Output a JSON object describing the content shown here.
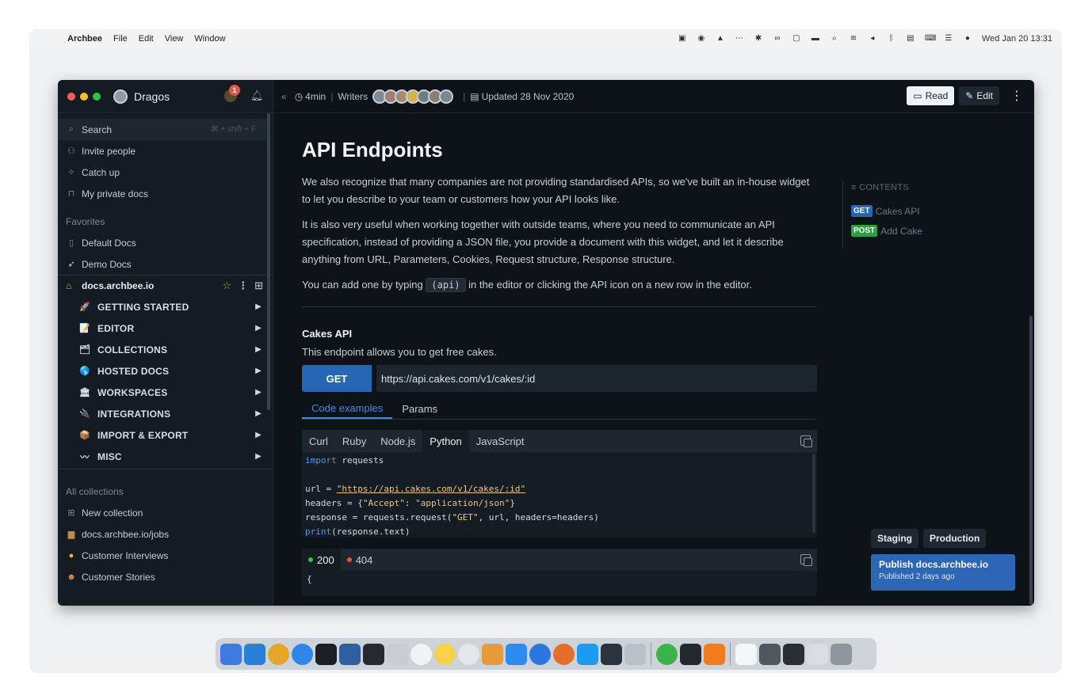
{
  "menubar": {
    "app": "Archbee",
    "items": [
      "File",
      "Edit",
      "View",
      "Window"
    ],
    "clock": "Wed Jan 20  13:31"
  },
  "sidebar": {
    "user": "Dragos",
    "notif_count": "1",
    "search": {
      "label": "Search",
      "shortcut": "⌘ + shift + F"
    },
    "top_items": [
      {
        "label": "Invite people",
        "icon": "user-plus-icon"
      },
      {
        "label": "Catch up",
        "icon": "sparkle-icon"
      },
      {
        "label": "My private docs",
        "icon": "lock-icon"
      }
    ],
    "favorites_label": "Favorites",
    "favorites": [
      {
        "label": "Default Docs",
        "icon": "doc-icon"
      },
      {
        "label": "Demo Docs",
        "icon": "bird-icon"
      }
    ],
    "space": "docs.archbee.io",
    "categories": [
      {
        "label": "GETTING STARTED",
        "emoji": "🚀"
      },
      {
        "label": "EDITOR",
        "emoji": "📝"
      },
      {
        "label": "COLLECTIONS",
        "emoji": "🗂"
      },
      {
        "label": "HOSTED DOCS",
        "emoji": "🌎"
      },
      {
        "label": "WORKSPACES",
        "emoji": "🏛"
      },
      {
        "label": "INTEGRATIONS",
        "emoji": "🔌"
      },
      {
        "label": "IMPORT & EXPORT",
        "emoji": "📦"
      },
      {
        "label": "MISC",
        "emoji": "〰"
      }
    ],
    "all_collections_label": "All collections",
    "collections": [
      {
        "label": "New collection",
        "icon": "plus-box-icon"
      },
      {
        "label": "docs.archbee.io/jobs",
        "icon": "briefcase-icon"
      },
      {
        "label": "Customer Interviews",
        "icon": "yellow-circle-icon"
      },
      {
        "label": "Customer Stories",
        "icon": "smiley-icon"
      }
    ]
  },
  "topbar": {
    "read_time": "4min",
    "writers_label": "Writers",
    "updated": "Updated 28 Nov 2020",
    "read_label": "Read",
    "edit_label": "Edit"
  },
  "doc": {
    "title": "API Endpoints",
    "p1": "We also recognize that many companies are not providing standardised APIs, so we've built an in-house widget to let you describe to your team or customers how your API looks like.",
    "p2": "It is also very useful when working together with outside teams, where you need to communicate an API specification, instead of providing a JSON file, you provide a document with this widget, and let it describe anything from URL, Parameters, Cookies, Request structure, Response structure.",
    "p3_before": "You can add one by typing",
    "p3_code": "(api)",
    "p3_after": "in the editor or clicking the API icon on a new row in the editor.",
    "endpoint": {
      "title": "Cakes API",
      "description": "This endpoint allows you to get free cakes.",
      "method": "GET",
      "url": "https://api.cakes.com/v1/cakes/:id",
      "tabs": [
        "Code examples",
        "Params"
      ],
      "languages": [
        "Curl",
        "Ruby",
        "Node.js",
        "Python",
        "JavaScript"
      ],
      "active_language": "Python",
      "code": {
        "l1_kw": "import",
        "l1_rest": " requests",
        "l3_a": "url = ",
        "l3_url": "\"https://api.cakes.com/v1/cakes/:id\"",
        "l4_a": "headers = {",
        "l4_s1": "\"Accept\"",
        "l4_b": ": ",
        "l4_s2": "\"application/json\"",
        "l4_c": "}",
        "l5_a": "response = requests.request(",
        "l5_s": "\"GET\"",
        "l5_b": ", url, headers=headers)",
        "l6_kw": "print",
        "l6_rest": "(response.text)"
      },
      "responses": [
        {
          "code": "200",
          "color": "#3fb950"
        },
        {
          "code": "404",
          "color": "#e5534b"
        }
      ],
      "response_body": "{"
    }
  },
  "toc": {
    "label": "CONTENTS",
    "items": [
      {
        "method": "GET",
        "label": "Cakes API",
        "color": "#2765b5"
      },
      {
        "method": "POST",
        "label": "Add Cake",
        "color": "#2ea043"
      }
    ]
  },
  "publish": {
    "env_staging": "Staging",
    "env_production": "Production",
    "title": "Publish docs.archbee.io",
    "subtitle": "Published 2 days ago"
  }
}
